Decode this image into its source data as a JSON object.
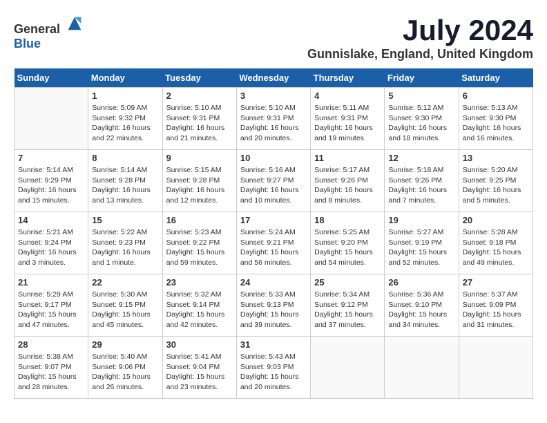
{
  "header": {
    "logo_general": "General",
    "logo_blue": "Blue",
    "month_title": "July 2024",
    "location": "Gunnislake, England, United Kingdom"
  },
  "calendar": {
    "days_of_week": [
      "Sunday",
      "Monday",
      "Tuesday",
      "Wednesday",
      "Thursday",
      "Friday",
      "Saturday"
    ],
    "weeks": [
      [
        {
          "day": "",
          "info": ""
        },
        {
          "day": "1",
          "info": "Sunrise: 5:09 AM\nSunset: 9:32 PM\nDaylight: 16 hours\nand 22 minutes."
        },
        {
          "day": "2",
          "info": "Sunrise: 5:10 AM\nSunset: 9:31 PM\nDaylight: 16 hours\nand 21 minutes."
        },
        {
          "day": "3",
          "info": "Sunrise: 5:10 AM\nSunset: 9:31 PM\nDaylight: 16 hours\nand 20 minutes."
        },
        {
          "day": "4",
          "info": "Sunrise: 5:11 AM\nSunset: 9:31 PM\nDaylight: 16 hours\nand 19 minutes."
        },
        {
          "day": "5",
          "info": "Sunrise: 5:12 AM\nSunset: 9:30 PM\nDaylight: 16 hours\nand 18 minutes."
        },
        {
          "day": "6",
          "info": "Sunrise: 5:13 AM\nSunset: 9:30 PM\nDaylight: 16 hours\nand 16 minutes."
        }
      ],
      [
        {
          "day": "7",
          "info": "Sunrise: 5:14 AM\nSunset: 9:29 PM\nDaylight: 16 hours\nand 15 minutes."
        },
        {
          "day": "8",
          "info": "Sunrise: 5:14 AM\nSunset: 9:28 PM\nDaylight: 16 hours\nand 13 minutes."
        },
        {
          "day": "9",
          "info": "Sunrise: 5:15 AM\nSunset: 9:28 PM\nDaylight: 16 hours\nand 12 minutes."
        },
        {
          "day": "10",
          "info": "Sunrise: 5:16 AM\nSunset: 9:27 PM\nDaylight: 16 hours\nand 10 minutes."
        },
        {
          "day": "11",
          "info": "Sunrise: 5:17 AM\nSunset: 9:26 PM\nDaylight: 16 hours\nand 8 minutes."
        },
        {
          "day": "12",
          "info": "Sunrise: 5:18 AM\nSunset: 9:26 PM\nDaylight: 16 hours\nand 7 minutes."
        },
        {
          "day": "13",
          "info": "Sunrise: 5:20 AM\nSunset: 9:25 PM\nDaylight: 16 hours\nand 5 minutes."
        }
      ],
      [
        {
          "day": "14",
          "info": "Sunrise: 5:21 AM\nSunset: 9:24 PM\nDaylight: 16 hours\nand 3 minutes."
        },
        {
          "day": "15",
          "info": "Sunrise: 5:22 AM\nSunset: 9:23 PM\nDaylight: 16 hours\nand 1 minute."
        },
        {
          "day": "16",
          "info": "Sunrise: 5:23 AM\nSunset: 9:22 PM\nDaylight: 15 hours\nand 59 minutes."
        },
        {
          "day": "17",
          "info": "Sunrise: 5:24 AM\nSunset: 9:21 PM\nDaylight: 15 hours\nand 56 minutes."
        },
        {
          "day": "18",
          "info": "Sunrise: 5:25 AM\nSunset: 9:20 PM\nDaylight: 15 hours\nand 54 minutes."
        },
        {
          "day": "19",
          "info": "Sunrise: 5:27 AM\nSunset: 9:19 PM\nDaylight: 15 hours\nand 52 minutes."
        },
        {
          "day": "20",
          "info": "Sunrise: 5:28 AM\nSunset: 9:18 PM\nDaylight: 15 hours\nand 49 minutes."
        }
      ],
      [
        {
          "day": "21",
          "info": "Sunrise: 5:29 AM\nSunset: 9:17 PM\nDaylight: 15 hours\nand 47 minutes."
        },
        {
          "day": "22",
          "info": "Sunrise: 5:30 AM\nSunset: 9:15 PM\nDaylight: 15 hours\nand 45 minutes."
        },
        {
          "day": "23",
          "info": "Sunrise: 5:32 AM\nSunset: 9:14 PM\nDaylight: 15 hours\nand 42 minutes."
        },
        {
          "day": "24",
          "info": "Sunrise: 5:33 AM\nSunset: 9:13 PM\nDaylight: 15 hours\nand 39 minutes."
        },
        {
          "day": "25",
          "info": "Sunrise: 5:34 AM\nSunset: 9:12 PM\nDaylight: 15 hours\nand 37 minutes."
        },
        {
          "day": "26",
          "info": "Sunrise: 5:36 AM\nSunset: 9:10 PM\nDaylight: 15 hours\nand 34 minutes."
        },
        {
          "day": "27",
          "info": "Sunrise: 5:37 AM\nSunset: 9:09 PM\nDaylight: 15 hours\nand 31 minutes."
        }
      ],
      [
        {
          "day": "28",
          "info": "Sunrise: 5:38 AM\nSunset: 9:07 PM\nDaylight: 15 hours\nand 28 minutes."
        },
        {
          "day": "29",
          "info": "Sunrise: 5:40 AM\nSunset: 9:06 PM\nDaylight: 15 hours\nand 26 minutes."
        },
        {
          "day": "30",
          "info": "Sunrise: 5:41 AM\nSunset: 9:04 PM\nDaylight: 15 hours\nand 23 minutes."
        },
        {
          "day": "31",
          "info": "Sunrise: 5:43 AM\nSunset: 9:03 PM\nDaylight: 15 hours\nand 20 minutes."
        },
        {
          "day": "",
          "info": ""
        },
        {
          "day": "",
          "info": ""
        },
        {
          "day": "",
          "info": ""
        }
      ]
    ]
  }
}
